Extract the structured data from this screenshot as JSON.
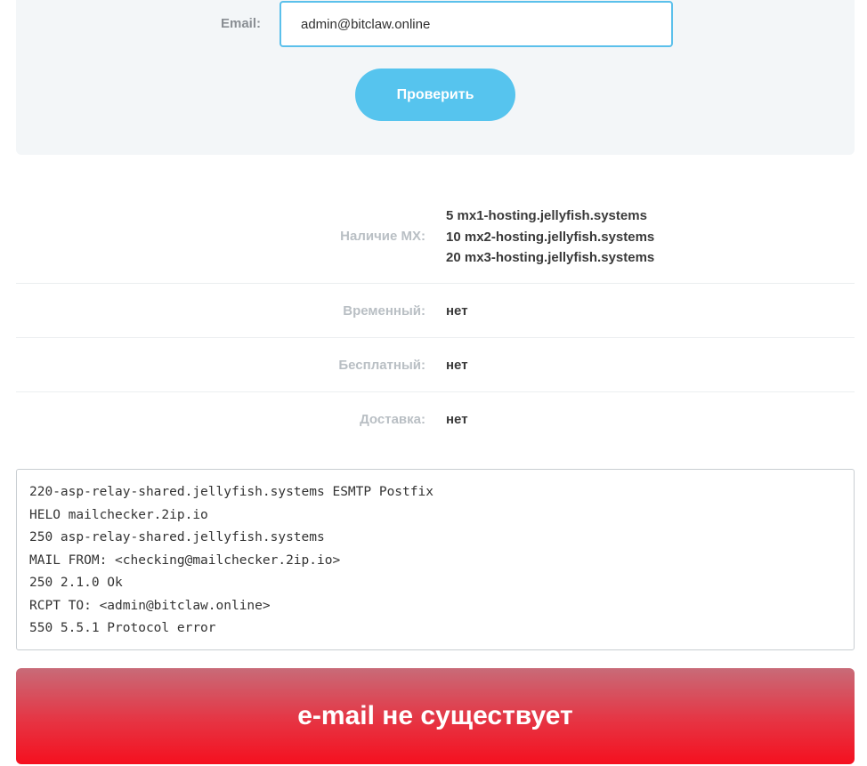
{
  "form": {
    "email_label": "Email:",
    "email_value": "admin@bitclaw.online",
    "check_button_label": "Проверить"
  },
  "results": {
    "mx": {
      "label": "Наличие MX:",
      "records": [
        {
          "priority": "5",
          "host": "mx1-hosting.jellyfish.systems"
        },
        {
          "priority": "10",
          "host": "mx2-hosting.jellyfish.systems"
        },
        {
          "priority": "20",
          "host": "mx3-hosting.jellyfish.systems"
        }
      ]
    },
    "temporary": {
      "label": "Временный:",
      "value": "нет"
    },
    "free": {
      "label": "Бесплатный:",
      "value": "нет"
    },
    "delivery": {
      "label": "Доставка:",
      "value": "нет"
    }
  },
  "smtp_log": [
    "220-asp-relay-shared.jellyfish.systems ESMTP Postfix",
    "HELO mailchecker.2ip.io",
    "250 asp-relay-shared.jellyfish.systems",
    "MAIL FROM: <checking@mailchecker.2ip.io>",
    "250 2.1.0 Ok",
    "RCPT TO: <admin@bitclaw.online>",
    "550 5.5.1 Protocol error"
  ],
  "verdict": {
    "text": "e-mail не существует",
    "color": "#f5101f"
  },
  "colors": {
    "accent": "#56c4ee",
    "panel_bg": "#f3f6f8"
  }
}
